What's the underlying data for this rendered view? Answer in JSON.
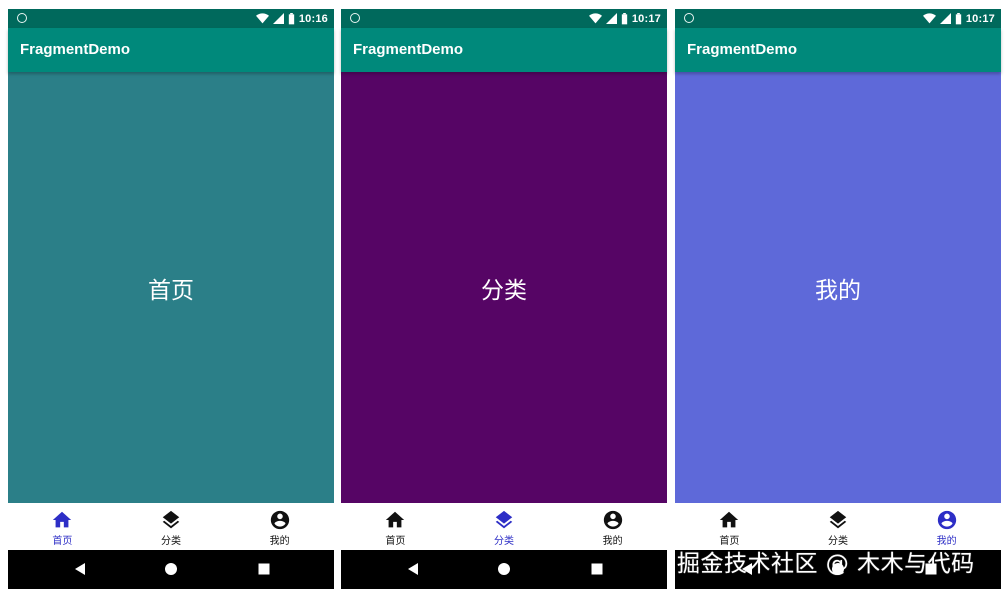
{
  "colors": {
    "status_bar": "#00695c",
    "app_bar": "#00897b",
    "nav_active": "#2d2ec6",
    "nav_inactive": "#111111"
  },
  "screens": [
    {
      "status_time": "10:16",
      "app_title": "FragmentDemo",
      "content_label": "首页",
      "content_color": "#2b7f88",
      "active_tab": "首页"
    },
    {
      "status_time": "10:17",
      "app_title": "FragmentDemo",
      "content_label": "分类",
      "content_color": "#560565",
      "active_tab": "分类"
    },
    {
      "status_time": "10:17",
      "app_title": "FragmentDemo",
      "content_label": "我的",
      "content_color": "#5e69d9",
      "active_tab": "我的"
    }
  ],
  "bottom_nav": [
    {
      "label": "首页",
      "icon": "home-icon"
    },
    {
      "label": "分类",
      "icon": "layers-icon"
    },
    {
      "label": "我的",
      "icon": "account-circle-icon"
    }
  ],
  "system_nav": [
    "back-icon",
    "home-circle-icon",
    "recents-square-icon"
  ],
  "watermark": "掘金技术社区 @ 木木与代码"
}
